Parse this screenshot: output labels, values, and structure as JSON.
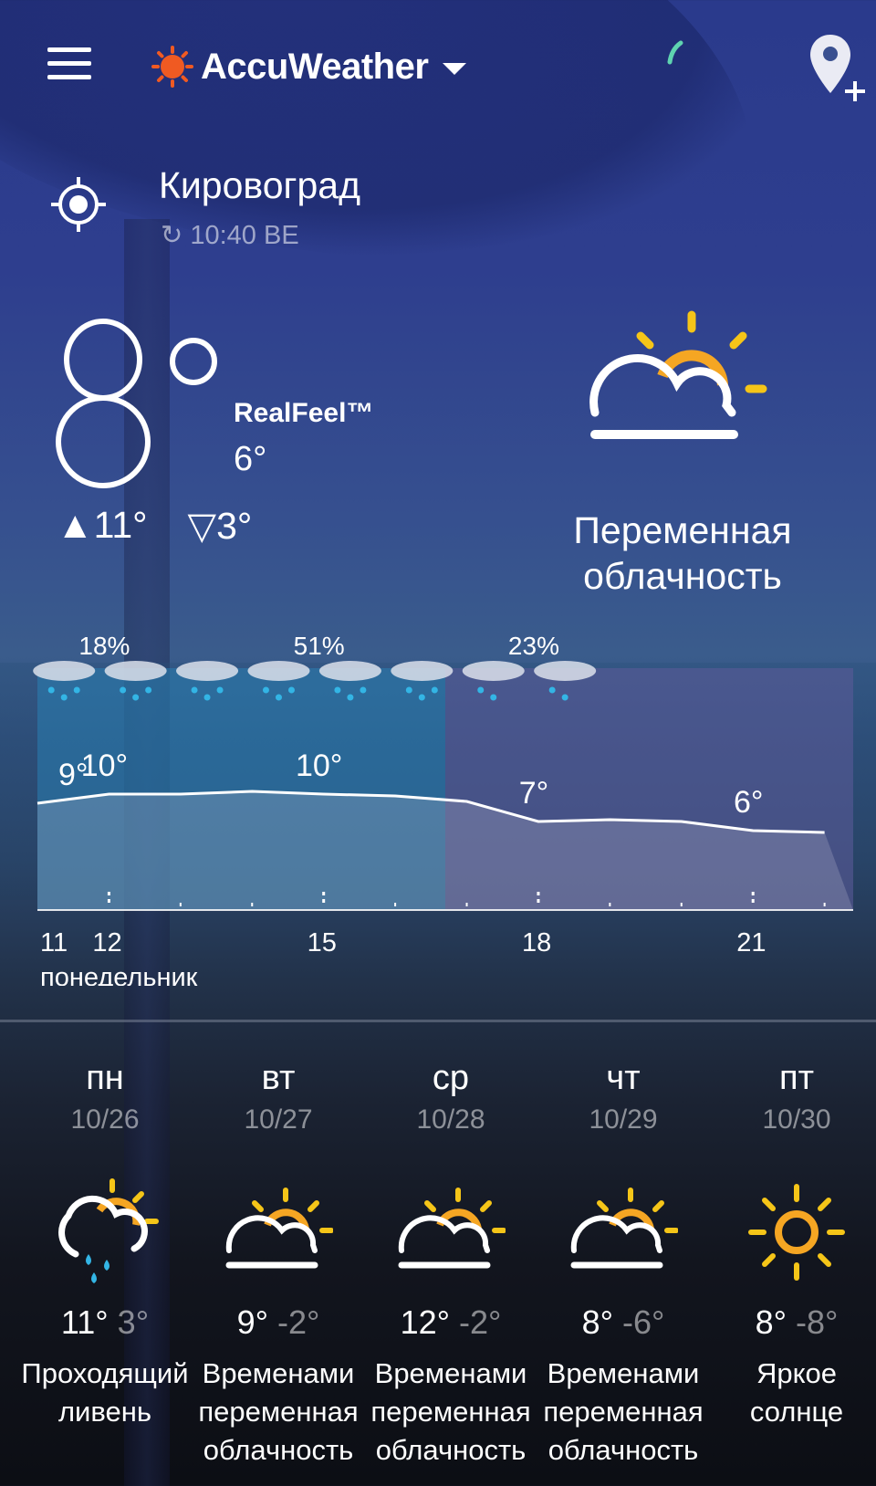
{
  "header": {
    "brand": "AccuWeather"
  },
  "location": {
    "city": "Кировоград",
    "updated": "10:40 ВЕ"
  },
  "current": {
    "temp_digits": "8",
    "realfeel_label": "RealFeel™",
    "realfeel_value": "6°",
    "high": "▲11°",
    "low": "▽3°",
    "condition_line1": "Переменная",
    "condition_line2": "облачность",
    "icon": "partly-sunny-icon"
  },
  "hourly": {
    "precip_labels": [
      {
        "text": "18%",
        "hour": 12
      },
      {
        "text": "51%",
        "hour": 15
      },
      {
        "text": "23%",
        "hour": 18
      }
    ],
    "temps": [
      {
        "hour": 11,
        "value": 9
      },
      {
        "hour": 12,
        "value": 10
      },
      {
        "hour": 13,
        "value": 10
      },
      {
        "hour": 14,
        "value": 10.3
      },
      {
        "hour": 15,
        "value": 10
      },
      {
        "hour": 16,
        "value": 9.8
      },
      {
        "hour": 17,
        "value": 9.2
      },
      {
        "hour": 18,
        "value": 7
      },
      {
        "hour": 19,
        "value": 7.2
      },
      {
        "hour": 20,
        "value": 7
      },
      {
        "hour": 21,
        "value": 6
      },
      {
        "hour": 22,
        "value": 5.8
      }
    ],
    "temp_labels": [
      {
        "text": "9°",
        "hour": 11
      },
      {
        "text": "10°",
        "hour": 12
      },
      {
        "text": "10°",
        "hour": 15
      },
      {
        "text": "7°",
        "hour": 18
      },
      {
        "text": "6°",
        "hour": 21
      }
    ],
    "hour_labels": [
      "11",
      "12",
      "15",
      "18",
      "21"
    ],
    "day_label": "понедельник",
    "rain_until_hour": 16.7
  },
  "daily": [
    {
      "name": "пн",
      "date": "10/26",
      "hi": "11°",
      "lo": "3°",
      "cond1": "Проходящий",
      "cond2": "ливень",
      "icon": "sun-cloud-rain-icon"
    },
    {
      "name": "вт",
      "date": "10/27",
      "hi": "9°",
      "lo": "-2°",
      "cond1": "Временами",
      "cond2": "переменная",
      "cond3": "облачность",
      "icon": "partly-sunny-icon"
    },
    {
      "name": "ср",
      "date": "10/28",
      "hi": "12°",
      "lo": "-2°",
      "cond1": "Временами",
      "cond2": "переменная",
      "cond3": "облачность",
      "icon": "partly-sunny-icon"
    },
    {
      "name": "чт",
      "date": "10/29",
      "hi": "8°",
      "lo": "-6°",
      "cond1": "Временами",
      "cond2": "переменная",
      "cond3": "облачность",
      "icon": "partly-sunny-icon"
    },
    {
      "name": "пт",
      "date": "10/30",
      "hi": "8°",
      "lo": "-8°",
      "cond1": "Яркое",
      "cond2": "солнце",
      "icon": "sun-icon"
    }
  ],
  "colors": {
    "sun": "#f5a623",
    "logo": "#f05a22",
    "rain_drop": "#33b5e5",
    "rain_band": "#2a7fb2",
    "cloudy_band": "#5a5a98"
  }
}
